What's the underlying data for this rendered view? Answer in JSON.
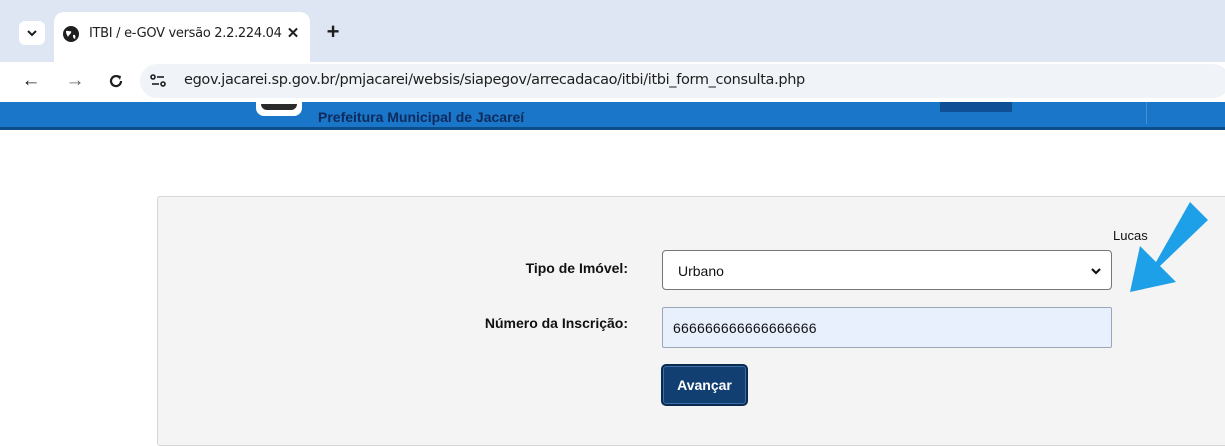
{
  "browser": {
    "tab": {
      "title": "ITBI / e-GOV versão 2.2.224.04",
      "close_glyph": "✕"
    },
    "new_tab_glyph": "+",
    "nav": {
      "back_glyph": "←",
      "forward_glyph": "→",
      "reload_glyph": "C"
    },
    "url": "egov.jacarei.sp.gov.br/pmjacarei/websis/siapegov/arrecadacao/itbi/itbi_form_consulta.php",
    "icons": [
      "tab-search-icon",
      "globe-icon",
      "close-icon",
      "plus-icon",
      "back-arrow-icon",
      "forward-arrow-icon",
      "reload-icon",
      "site-settings-icon"
    ]
  },
  "header": {
    "title": "Prefeitura Municipal de Jacareí",
    "color": "#1976c9"
  },
  "user": {
    "name_visible": "Lucas"
  },
  "form": {
    "property_type": {
      "label": "Tipo de Imóvel:",
      "value": "Urbano"
    },
    "registration_number": {
      "label": "Número da Inscrição:",
      "value": "666666666666666666"
    },
    "submit_label": "Avançar",
    "submit_color": "#123f72"
  },
  "annotation": {
    "icon": "pointer-arrow-icon",
    "color": "#1ea0e8"
  }
}
